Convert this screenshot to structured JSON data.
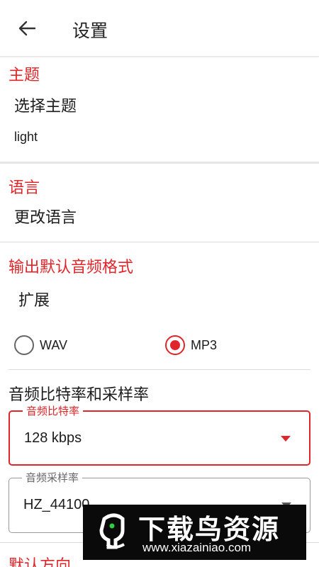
{
  "header": {
    "title": "设置",
    "back_icon": "arrow-left-icon"
  },
  "theme": {
    "section": "主题",
    "item": "选择主题",
    "value": "light"
  },
  "language": {
    "section": "语言",
    "item": "更改语言"
  },
  "output": {
    "section": "输出默认音频格式",
    "item": "扩展",
    "options": [
      {
        "label": "WAV",
        "selected": false
      },
      {
        "label": "MP3",
        "selected": true
      }
    ]
  },
  "bitrate_section": {
    "title": "音频比特率和采样率",
    "bitrate": {
      "label": "音频比特率",
      "value": "128 kbps"
    },
    "samplerate": {
      "label": "音频采样率",
      "value": "HZ_44100"
    }
  },
  "orientation": {
    "section": "默认方向"
  },
  "watermark": {
    "title": "下载鸟资源",
    "url": "www.xiazainiao.com"
  },
  "colors": {
    "accent": "#e0262a",
    "text": "#1c1c1c",
    "divider": "#dcdcdc"
  }
}
